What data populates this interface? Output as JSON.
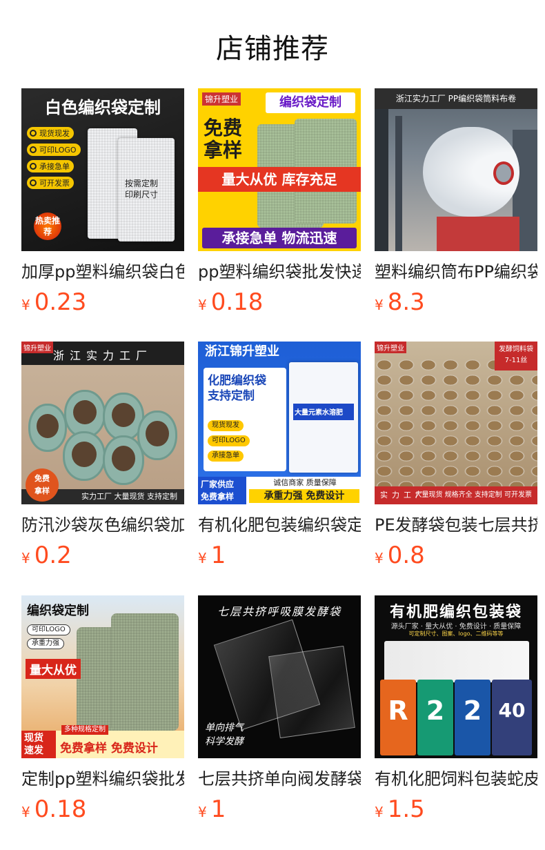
{
  "page": {
    "title": "店铺推荐"
  },
  "products": [
    {
      "title": "加厚pp塑料编织袋白色",
      "currency": "¥",
      "price": "0.23",
      "image": {
        "headline": "白色编织袋定制",
        "tags": [
          "现货现发",
          "可印LOGO",
          "承接急单",
          "可开发票"
        ],
        "note_lines": [
          "按需定制",
          "印刷尺寸"
        ],
        "badge": "热卖推荐"
      }
    },
    {
      "title": "pp塑料编织袋批发快递",
      "currency": "¥",
      "price": "0.18",
      "image": {
        "brand": "锦升塑业",
        "headline": "编织袋定制",
        "free_lines": [
          "免费",
          "拿样"
        ],
        "band": "量大从优 库存充足",
        "footer": "承接急单 物流迅速"
      }
    },
    {
      "title": "塑料编织筒布PP编织袋",
      "currency": "¥",
      "price": "8.3",
      "image": {
        "caption": "浙江实力工厂 PP编织袋筒料布卷"
      }
    },
    {
      "title": "防汛沙袋灰色编织袋加厚",
      "currency": "¥",
      "price": "0.2",
      "image": {
        "brand": "锦升塑业",
        "top": "浙江实力工厂",
        "badge_lines": [
          "免费",
          "拿样"
        ],
        "bottom": "实力工厂 大量现货 支持定制"
      }
    },
    {
      "title": "有机化肥包装编织袋定制",
      "currency": "¥",
      "price": "1",
      "image": {
        "header": "浙江锦升塑业",
        "headline_lines": [
          "化肥编织袋",
          "支持定制"
        ],
        "chips": [
          "现货现发",
          "可印LOGO",
          "承接急单"
        ],
        "bag_label": "大量元素水溶肥",
        "foot_a_lines": [
          "厂家供应",
          "免费拿样"
        ],
        "foot_b": "诚信商家 质量保障",
        "foot_c": "承重力强 免费设计"
      }
    },
    {
      "title": "PE发酵袋包装七层共挤",
      "currency": "¥",
      "price": "0.8",
      "image": {
        "brand": "锦升塑业",
        "corner_lines": [
          "发酵饲料袋",
          "7-11丝"
        ],
        "bottom_left": "实力工厂",
        "bottom": "大量现货 规格齐全 支持定制 可开发票"
      }
    },
    {
      "title": "定制pp塑料编织袋批发",
      "currency": "¥",
      "price": "0.18",
      "image": {
        "headline": "编织袋定制",
        "pills": [
          "可印LOGO",
          "承重力强"
        ],
        "red": "量大从优",
        "ribbon_a_lines": [
          "现货",
          "速发"
        ],
        "ribbon_b": "多种规格定制",
        "ribbon_c": "免费拿样 免费设计"
      }
    },
    {
      "title": "七层共挤单向阀发酵袋",
      "currency": "¥",
      "price": "1",
      "image": {
        "headline": "七层共挤呼吸膜发酵袋",
        "footer_lines": [
          "单向排气",
          "科学发酵"
        ]
      }
    },
    {
      "title": "有机化肥饲料包装蛇皮袋",
      "currency": "¥",
      "price": "1.5",
      "image": {
        "headline": "有机肥编织包装袋",
        "sub": "源头厂家 · 量大从优 · 免费设计 · 质量保障",
        "sub2": "可定制尺寸、图案、logo、二维码等等",
        "bag_marks": [
          "R",
          "2",
          "2",
          "40"
        ]
      }
    }
  ]
}
